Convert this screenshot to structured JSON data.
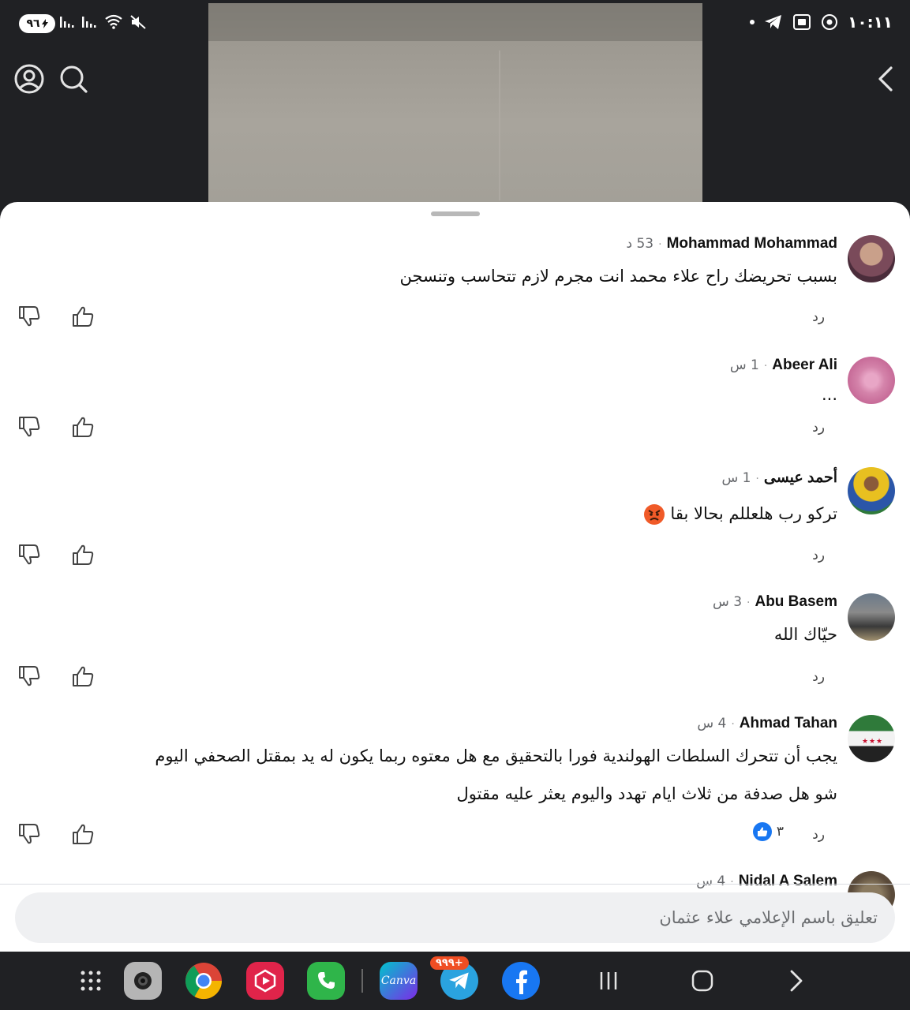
{
  "status_bar": {
    "battery": "٩٦",
    "clock": "١٠:١١"
  },
  "comments": [
    {
      "author": "Mohammad Mohammad",
      "time": "53 د",
      "lines": [
        "بسبب تحريضك راح علاء محمد انت مجرم لازم تتحاسب وتنسجن"
      ],
      "reply_label": "رد"
    },
    {
      "author": "Abeer Ali",
      "time": "1 س",
      "lines": [
        "..."
      ],
      "reply_label": "رد"
    },
    {
      "author": "أحمد عيسى",
      "time": "1 س",
      "lines": [
        "تركو رب هلعللم بحالا بقا"
      ],
      "emoji": "angry-face",
      "reply_label": "رد"
    },
    {
      "author": "Abu Basem",
      "time": "3 س",
      "lines": [
        "حيّاك الله"
      ],
      "reply_label": "رد"
    },
    {
      "author": "Ahmad Tahan",
      "time": "4 س",
      "lines": [
        "يجب أن تتحرك السلطات الهولندية فورا بالتحقيق مع هل معتوه ربما يكون له يد بمقتل الصحفي اليوم",
        "شو هل صدفة من ثلاث ايام تهدد واليوم يعثر عليه مقتول"
      ],
      "reply_label": "رد",
      "reaction_count": "٣"
    },
    {
      "author": "Nidal A Salem",
      "time": "4 س"
    }
  ],
  "comment_input": {
    "placeholder": "تعليق باسم الإعلامي علاء عثمان"
  },
  "taskbar": {
    "canva_label": "Canva",
    "telegram_badge": "٩٩٩+"
  },
  "colors": {
    "accent": "#1877f2",
    "sheet_bg": "#ffffff",
    "chrome_bg": "#202124"
  }
}
